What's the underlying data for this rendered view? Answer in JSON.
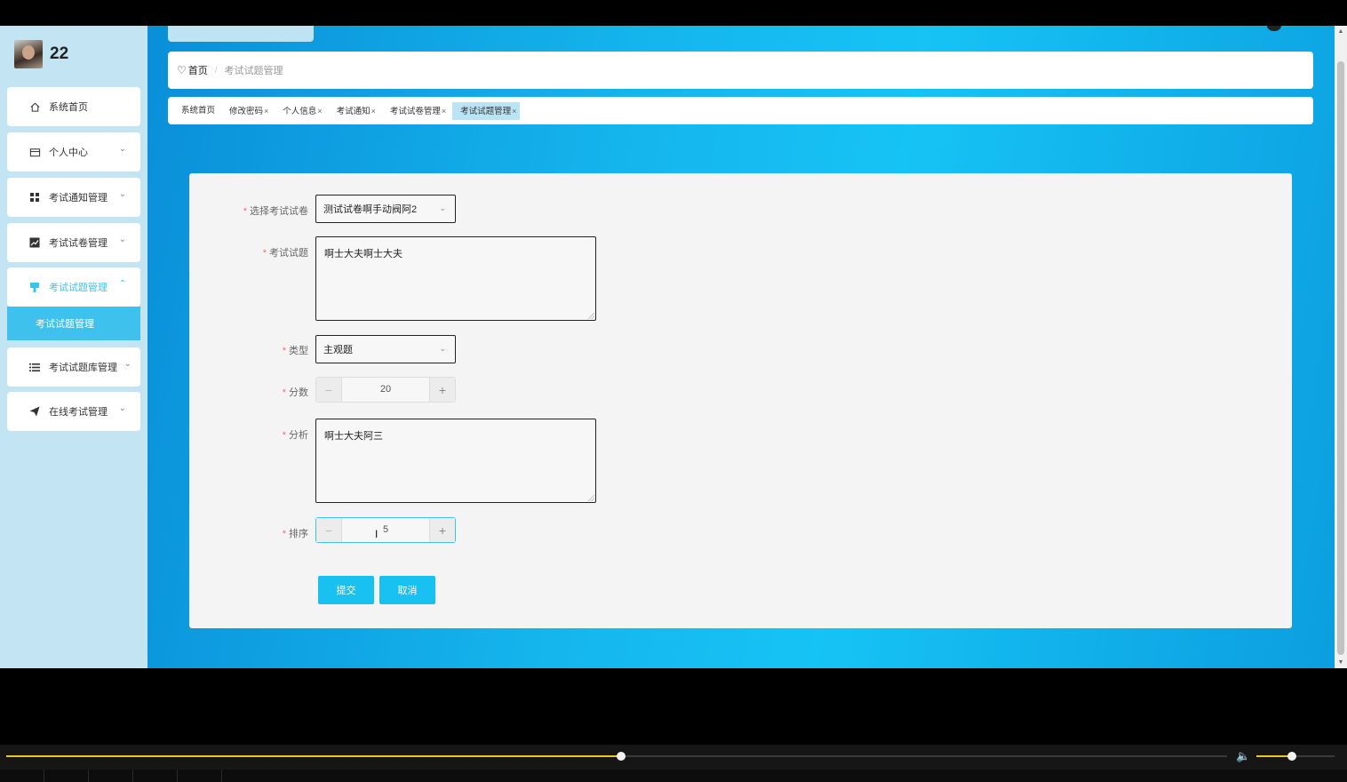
{
  "user": {
    "name": "22",
    "avatar_icon": "user-avatar"
  },
  "sidebar": {
    "items": [
      {
        "label": "系统首页",
        "icon": "home-icon",
        "expandable": false
      },
      {
        "label": "个人中心",
        "icon": "id-card-icon",
        "expandable": true
      },
      {
        "label": "考试通知管理",
        "icon": "grid-icon",
        "expandable": true
      },
      {
        "label": "考试试卷管理",
        "icon": "chart-icon",
        "expandable": true
      },
      {
        "label": "考试试题管理",
        "icon": "brush-icon",
        "expandable": true,
        "active": true
      },
      {
        "label": "考试试题库管理",
        "icon": "list-icon",
        "expandable": true
      },
      {
        "label": "在线考试管理",
        "icon": "send-icon",
        "expandable": true
      }
    ],
    "submenu": {
      "label": "考试试题管理"
    }
  },
  "breadcrumb": {
    "home": "首页",
    "separator": "/",
    "current": "考试试题管理"
  },
  "tabs": [
    {
      "label": "系统首页",
      "closable": false,
      "active": false
    },
    {
      "label": "修改密码",
      "closable": true,
      "active": false
    },
    {
      "label": "个人信息",
      "closable": true,
      "active": false
    },
    {
      "label": "考试通知",
      "closable": true,
      "active": false
    },
    {
      "label": "考试试卷管理",
      "closable": true,
      "active": false
    },
    {
      "label": "考试试题管理",
      "closable": true,
      "active": true
    }
  ],
  "form": {
    "paper": {
      "label": "选择考试试卷",
      "value": "测试试卷啊手动阀阿2"
    },
    "question": {
      "label": "考试试题",
      "value": "啊士大夫啊士大夫"
    },
    "type": {
      "label": "类型",
      "value": "主观题"
    },
    "score": {
      "label": "分数",
      "value": "20"
    },
    "analysis": {
      "label": "分析",
      "value": "啊士大夫阿三"
    },
    "order": {
      "label": "排序",
      "value": "5"
    },
    "submit_label": "提交",
    "cancel_label": "取消"
  },
  "player": {
    "progress": 0.504,
    "volume": 0.45
  },
  "colors": {
    "accent": "#19c1f1",
    "sidebar_bg": "#c3e4f3",
    "main_bg": "#15b6ee",
    "required": "#f56c6c",
    "seek": "#e9c530"
  }
}
